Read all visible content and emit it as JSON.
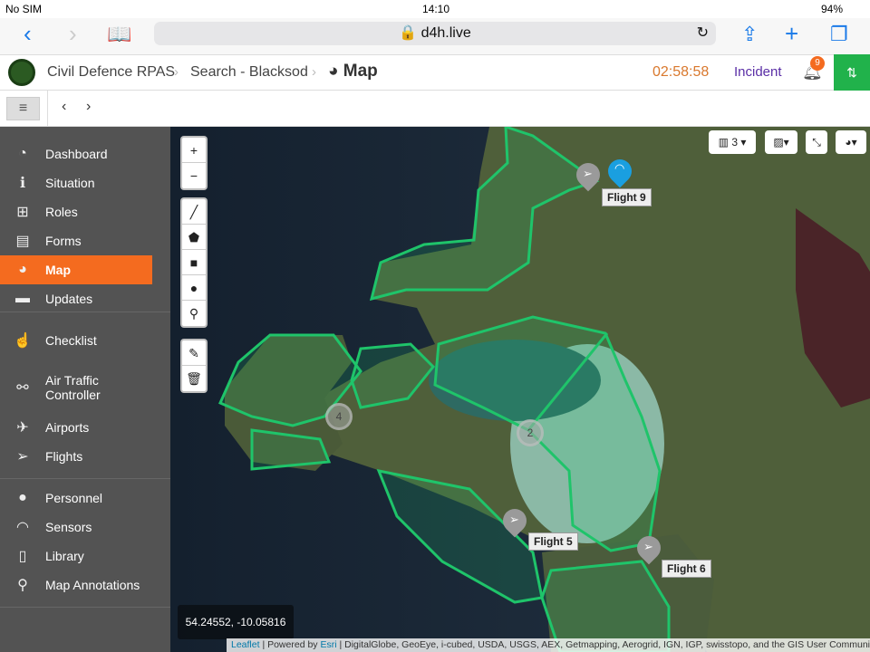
{
  "status_bar": {
    "carrier": "No SIM",
    "time": "14:10",
    "battery": "94%"
  },
  "browser": {
    "url": "d4h.live"
  },
  "header": {
    "org": "Civil Defence RPAS",
    "incident": "Search - Blacksod",
    "page": "Map",
    "timer": "02:58:58",
    "incident_label": "Incident",
    "notifications": "9"
  },
  "sidebar": {
    "items": [
      {
        "label": "Dashboard",
        "icon": "dashboard-icon",
        "glyph": "◔"
      },
      {
        "label": "Situation",
        "icon": "info-icon",
        "glyph": "ℹ"
      },
      {
        "label": "Roles",
        "icon": "sitemap-icon",
        "glyph": "⊞"
      },
      {
        "label": "Forms",
        "icon": "document-icon",
        "glyph": "▤"
      },
      {
        "label": "Map",
        "icon": "globe-icon",
        "glyph": "◕"
      },
      {
        "label": "Updates",
        "icon": "comment-icon",
        "glyph": "▬"
      },
      {
        "label": "Checklist",
        "icon": "thumbs-up-icon",
        "glyph": "☝"
      },
      {
        "label": "Air Traffic",
        "label2": "Controller",
        "icon": "binoculars-icon",
        "glyph": "⚯"
      },
      {
        "label": "Airports",
        "icon": "plane-icon",
        "glyph": "✈"
      },
      {
        "label": "Flights",
        "icon": "paper-plane-icon",
        "glyph": "➢"
      },
      {
        "label": "Personnel",
        "icon": "user-icon",
        "glyph": "●"
      },
      {
        "label": "Sensors",
        "icon": "rss-icon",
        "glyph": "◠"
      },
      {
        "label": "Library",
        "icon": "pdf-icon",
        "glyph": "▯"
      },
      {
        "label": "Map Annotations",
        "icon": "pin-icon",
        "glyph": "⚲"
      }
    ]
  },
  "map": {
    "layers_count": "3",
    "coords": "54.24552, -10.05816",
    "flights": [
      "Flight 9",
      "Flight 5",
      "Flight 6"
    ],
    "clusters": [
      "4",
      "2"
    ],
    "attribution": {
      "leaflet": "Leaflet",
      "powered": " | Powered by ",
      "esri": "Esri",
      "sources": " | DigitalGlobe, GeoEye, i-cubed, USDA, USGS, AEX, Getmapping, Aerogrid, IGN, IGP, swisstopo, and the GIS User Community"
    }
  },
  "colors": {
    "accent": "#f46b1f",
    "green": "#21b24b",
    "purple": "#5a2ea6",
    "timer": "#d9782d",
    "zone": "#1fc46a"
  }
}
